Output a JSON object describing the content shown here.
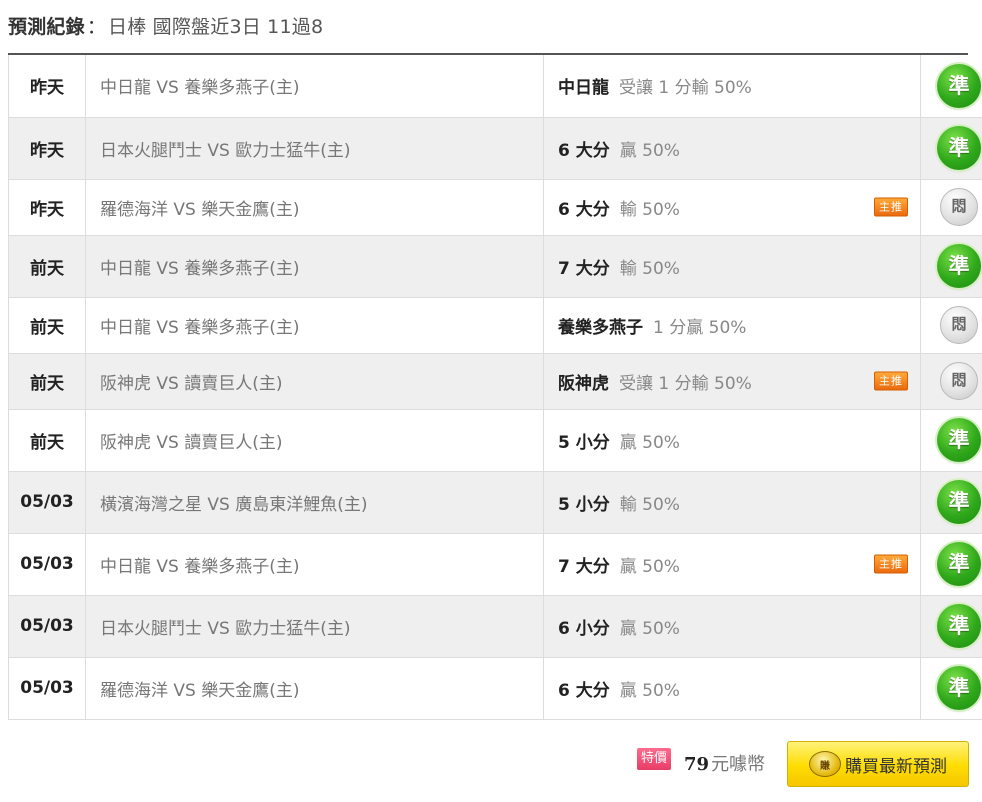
{
  "header": {
    "label": "預測紀錄",
    "colon": "：",
    "description": "日棒 國際盤近3日 11過8"
  },
  "rows": [
    {
      "date": "昨天",
      "match": "中日龍 VS 養樂多燕子(主)",
      "pick_main": "中日龍",
      "pick_detail": "受讓 1 分輸 50%",
      "tag": "",
      "result": "準",
      "result_type": "win"
    },
    {
      "date": "昨天",
      "match": "日本火腿鬥士 VS 歐力士猛牛(主)",
      "pick_main": "6 大分",
      "pick_detail": "贏 50%",
      "tag": "",
      "result": "準",
      "result_type": "win"
    },
    {
      "date": "昨天",
      "match": "羅德海洋 VS 樂天金鷹(主)",
      "pick_main": "6 大分",
      "pick_detail": "輸 50%",
      "tag": "主推",
      "result": "悶",
      "result_type": "tie"
    },
    {
      "date": "前天",
      "match": "中日龍 VS 養樂多燕子(主)",
      "pick_main": "7 大分",
      "pick_detail": "輸 50%",
      "tag": "",
      "result": "準",
      "result_type": "win"
    },
    {
      "date": "前天",
      "match": "中日龍 VS 養樂多燕子(主)",
      "pick_main": "養樂多燕子",
      "pick_detail": "1 分贏 50%",
      "tag": "",
      "result": "悶",
      "result_type": "tie"
    },
    {
      "date": "前天",
      "match": "阪神虎 VS 讀賣巨人(主)",
      "pick_main": "阪神虎",
      "pick_detail": "受讓 1 分輸 50%",
      "tag": "主推",
      "result": "悶",
      "result_type": "tie"
    },
    {
      "date": "前天",
      "match": "阪神虎 VS 讀賣巨人(主)",
      "pick_main": "5 小分",
      "pick_detail": "贏 50%",
      "tag": "",
      "result": "準",
      "result_type": "win"
    },
    {
      "date": "05/03",
      "match": "橫濱海灣之星 VS 廣島東洋鯉魚(主)",
      "pick_main": "5 小分",
      "pick_detail": "輸 50%",
      "tag": "",
      "result": "準",
      "result_type": "win"
    },
    {
      "date": "05/03",
      "match": "中日龍 VS 養樂多燕子(主)",
      "pick_main": "7 大分",
      "pick_detail": "贏 50%",
      "tag": "主推",
      "result": "準",
      "result_type": "win"
    },
    {
      "date": "05/03",
      "match": "日本火腿鬥士 VS 歐力士猛牛(主)",
      "pick_main": "6 小分",
      "pick_detail": "贏 50%",
      "tag": "",
      "result": "準",
      "result_type": "win"
    },
    {
      "date": "05/03",
      "match": "羅德海洋 VS 樂天金鷹(主)",
      "pick_main": "6 大分",
      "pick_detail": "贏 50%",
      "tag": "",
      "result": "準",
      "result_type": "win"
    }
  ],
  "footer": {
    "special_label": "特價",
    "price": "79",
    "currency": "元噱幣",
    "buy_icon": "賺",
    "buy_label": "購買最新預測"
  },
  "colors": {
    "win": "#2fa81b",
    "tie": "#c4c4c4",
    "tag": "#ea6b0f",
    "buy": "#ffdd00",
    "special": "#e73d67"
  }
}
